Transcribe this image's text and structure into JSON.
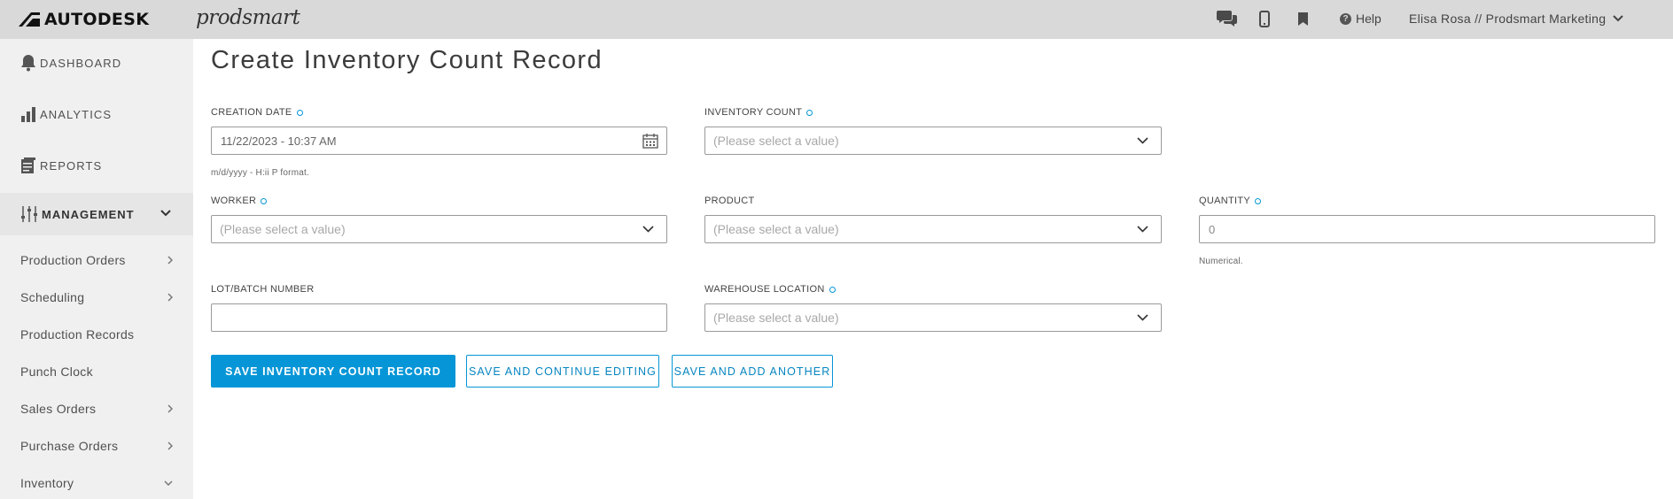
{
  "topbar": {
    "brand": "AUTODESK",
    "product": "prodsmart",
    "icons": [
      "chat-icon",
      "mobile-icon",
      "bookmark-icon"
    ],
    "help_label": "Help",
    "user_label": "Elisa Rosa // Prodsmart Marketing"
  },
  "sidebar": {
    "main": [
      {
        "label": "DASHBOARD",
        "icon": "bell-icon"
      },
      {
        "label": "ANALYTICS",
        "icon": "bar-chart-icon"
      },
      {
        "label": "REPORTS",
        "icon": "reports-icon"
      }
    ],
    "management": {
      "label": "MANAGEMENT",
      "icon": "sliders-icon",
      "expanded": true
    },
    "sub_items": [
      {
        "label": "Production Orders",
        "chevron": "right"
      },
      {
        "label": "Scheduling",
        "chevron": "right"
      },
      {
        "label": "Production Records",
        "chevron": ""
      },
      {
        "label": "Punch Clock",
        "chevron": ""
      },
      {
        "label": "Sales Orders",
        "chevron": "right"
      },
      {
        "label": "Purchase Orders",
        "chevron": "right"
      },
      {
        "label": "Inventory",
        "chevron": "down"
      }
    ]
  },
  "form": {
    "title": "Create Inventory Count Record",
    "creation_date": {
      "label": "CREATION DATE",
      "value": "11/22/2023 - 10:37 AM",
      "help": "m/d/yyyy - H:ii P format.",
      "required": true
    },
    "inventory_count": {
      "label": "INVENTORY COUNT",
      "placeholder": "(Please select a value)",
      "required": true
    },
    "worker": {
      "label": "WORKER",
      "placeholder": "(Please select a value)",
      "required": true
    },
    "product": {
      "label": "PRODUCT",
      "placeholder": "(Please select a value)",
      "required": false
    },
    "quantity": {
      "label": "QUANTITY",
      "value": "0",
      "help": "Numerical.",
      "required": true
    },
    "lot_batch": {
      "label": "LOT/BATCH NUMBER",
      "value": "",
      "required": false
    },
    "warehouse_location": {
      "label": "WAREHOUSE LOCATION",
      "placeholder": "(Please select a value)",
      "required": true
    }
  },
  "buttons": {
    "save": "SAVE INVENTORY COUNT RECORD",
    "save_continue": "SAVE AND CONTINUE EDITING",
    "save_add": "SAVE AND ADD ANOTHER"
  },
  "colors": {
    "accent": "#0696d7",
    "topbar_bg": "#d9d9d9",
    "sidebar_bg": "#f0f0f0"
  }
}
